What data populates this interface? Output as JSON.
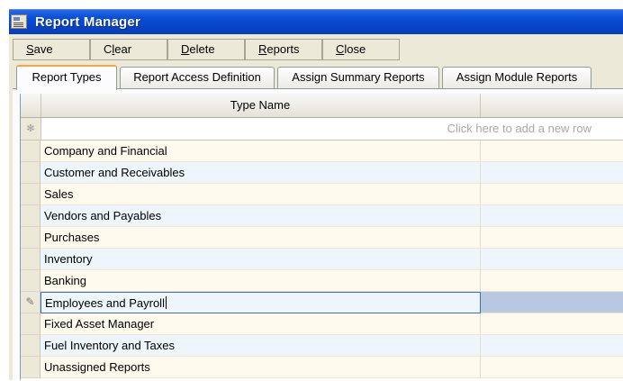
{
  "window": {
    "title": "Report Manager",
    "icon": "report-manager-app-icon"
  },
  "toolbar": {
    "buttons": [
      {
        "acc": "S",
        "rest": "ave"
      },
      {
        "acc": "",
        "pre": "C",
        "mid": "l",
        "rest": "ear"
      },
      {
        "acc": "D",
        "rest": "elete"
      },
      {
        "acc": "R",
        "rest": "eports"
      },
      {
        "acc": "C",
        "rest": "lose"
      }
    ]
  },
  "tabs": [
    {
      "label": "Report Types",
      "active": true
    },
    {
      "label": "Report Access Definition",
      "active": false
    },
    {
      "label": "Assign Summary Reports",
      "active": false
    },
    {
      "label": "Assign Module Reports",
      "active": false
    }
  ],
  "grid": {
    "columns": [
      "Type Name",
      ""
    ],
    "new_row_hint": "Click here to add a new row",
    "new_row_marker": "✻",
    "edit_marker": "✎",
    "rows": [
      "Company and Financial",
      "Customer and Receivables",
      "Sales",
      "Vendors and Payables",
      "Purchases",
      "Inventory",
      "Banking",
      "Employees and Payroll",
      "Fixed Asset Manager",
      "Fuel Inventory and Taxes",
      "Unassigned Reports"
    ],
    "editing_row_index": 7
  }
}
